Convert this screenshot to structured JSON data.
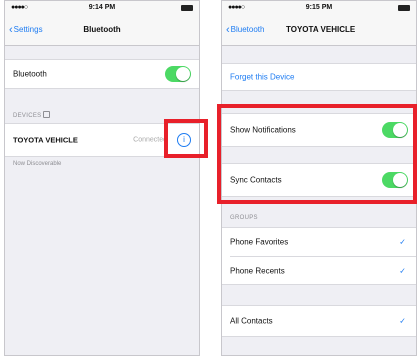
{
  "left": {
    "status": {
      "carrier": "●●●●○",
      "time": "9:14 PM"
    },
    "nav": {
      "back": "Settings",
      "title": "Bluetooth"
    },
    "bluetooth_label": "Bluetooth",
    "bluetooth_on": true,
    "devices_header": "DEVICES",
    "device": {
      "name": "TOYOTA VEHICLE",
      "status": "Connected"
    },
    "discoverable": "Now Discoverable"
  },
  "right": {
    "status": {
      "carrier": "●●●●○",
      "time": "9:15 PM"
    },
    "nav": {
      "back": "Bluetooth",
      "title": "TOYOTA VEHICLE"
    },
    "forget": "Forget this Device",
    "show_notifications": {
      "label": "Show Notifications",
      "on": true
    },
    "sync_contacts": {
      "label": "Sync Contacts",
      "on": true
    },
    "groups_header": "GROUPS",
    "groups": [
      {
        "label": "Phone Favorites",
        "checked": true
      },
      {
        "label": "Phone Recents",
        "checked": true
      },
      {
        "label": "All Contacts",
        "checked": true
      }
    ],
    "check_glyph": "✓"
  },
  "colors": {
    "accent": "#1e7cf2",
    "toggle_on": "#4cd964",
    "highlight": "#e8202a"
  }
}
